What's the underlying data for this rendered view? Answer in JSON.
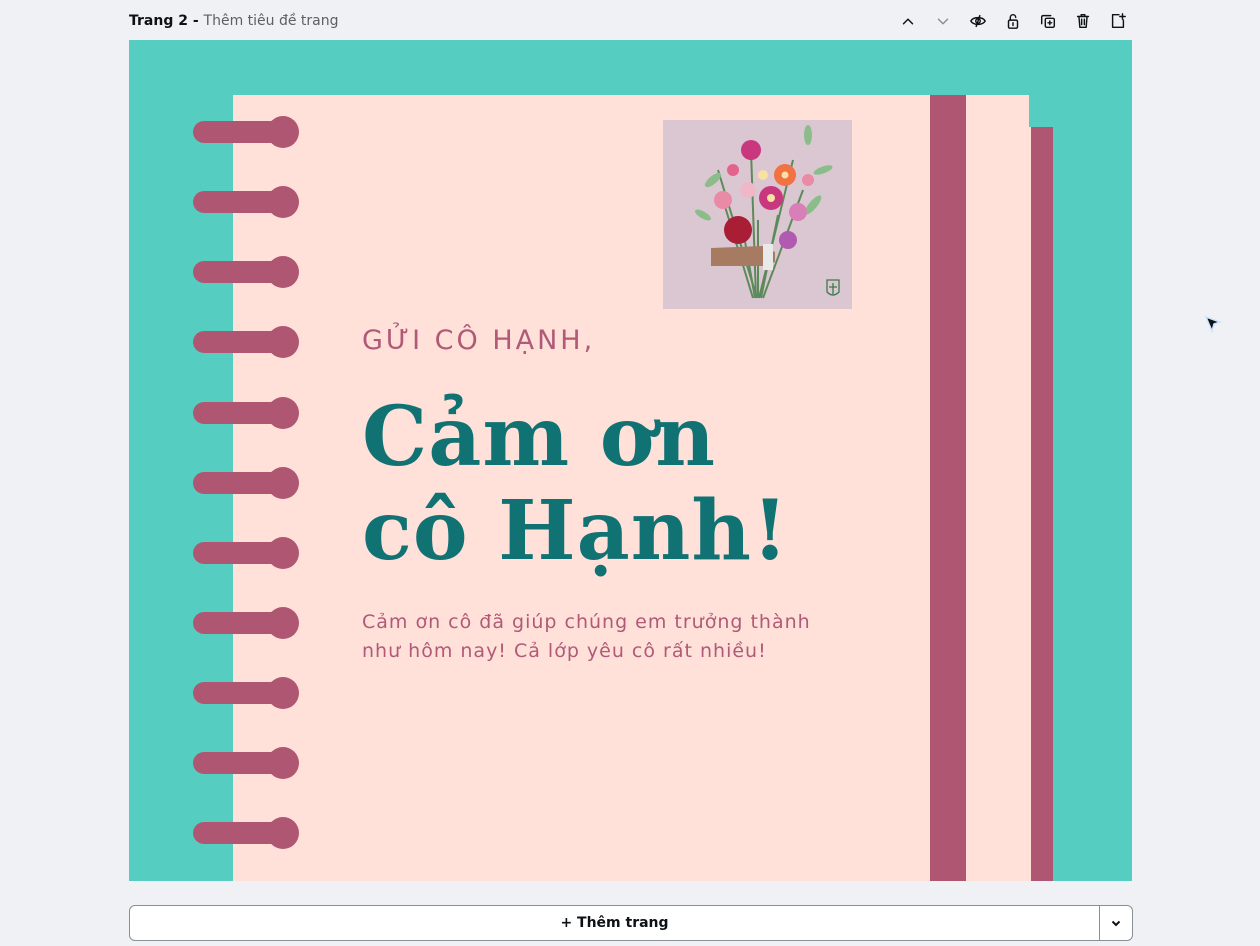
{
  "header": {
    "page_number": "Trang 2 - ",
    "page_title_placeholder": "Thêm tiêu đề trang",
    "toolbar": [
      {
        "name": "move-up-button",
        "icon": "chevron-up-icon"
      },
      {
        "name": "move-down-button",
        "icon": "chevron-down-icon"
      },
      {
        "name": "hide-page-button",
        "icon": "eye-slash-icon"
      },
      {
        "name": "lock-page-button",
        "icon": "lock-icon"
      },
      {
        "name": "duplicate-page-button",
        "icon": "duplicate-icon"
      },
      {
        "name": "delete-page-button",
        "icon": "trash-icon"
      },
      {
        "name": "add-page-after-button",
        "icon": "add-page-icon"
      }
    ]
  },
  "design": {
    "greeting": "GỬI CÔ HẠNH,",
    "headline_line1": "Cảm ơn",
    "headline_line2": "cô Hạnh!",
    "message_line1": "Cảm ơn cô đã giúp chúng em trưởng thành",
    "message_line2": "như hôm nay! Cả lớp yêu cô rất nhiều!",
    "image_icon": "flower-bouquet-illustration",
    "colors": {
      "background": "#55cec1",
      "paper": "#ffe1d9",
      "accent_pink": "#af5772",
      "headline": "#117273"
    }
  },
  "footer": {
    "add_page_label": "+ Thêm trang",
    "dropdown_icon": "chevron-down-icon"
  }
}
